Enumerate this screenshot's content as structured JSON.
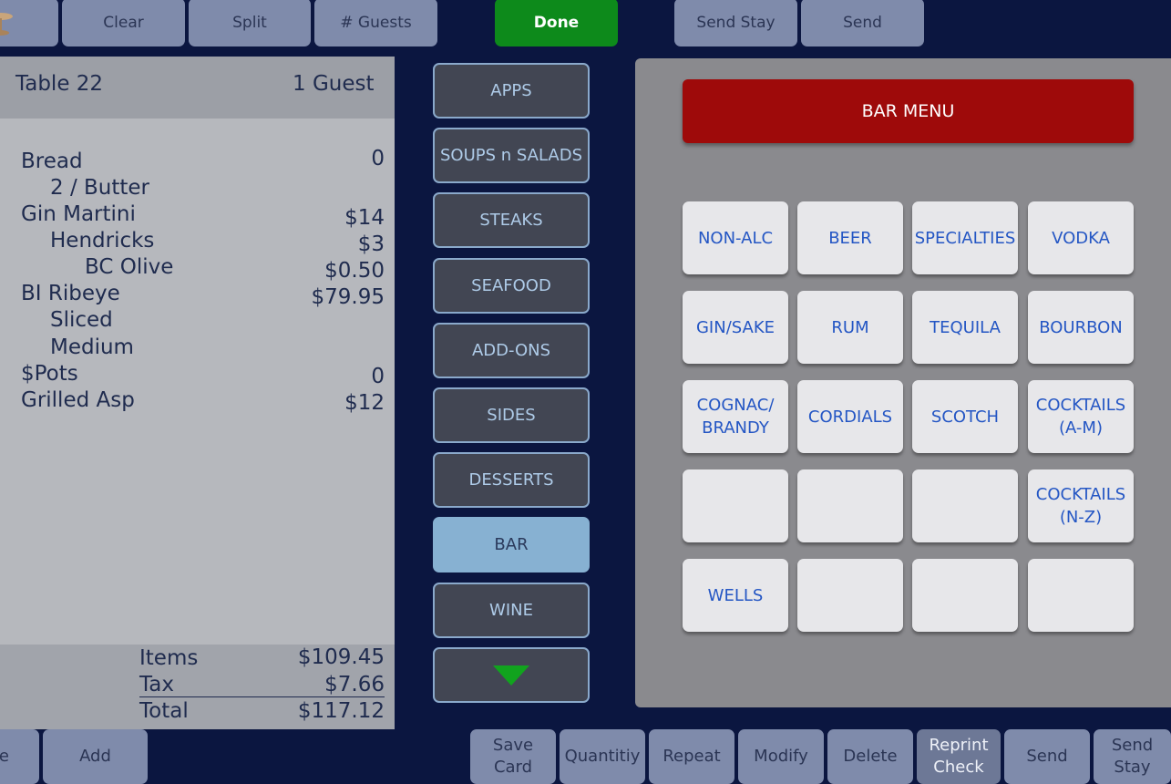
{
  "top_bar": {
    "clear": "Clear",
    "split": "Split",
    "guests": "# Guests",
    "done": "Done",
    "send_stay": "Send Stay",
    "send": "Send"
  },
  "check": {
    "table": "Table 22",
    "guests": "1 Guest",
    "items": [
      {
        "name": "Bread",
        "price": "0"
      },
      {
        "name": "2 / Butter",
        "price": ""
      },
      {
        "name": "Gin Martini",
        "price": "$14"
      },
      {
        "name": "Hendricks",
        "price": "$3"
      },
      {
        "name": "BC Olive",
        "price": "$0.50"
      },
      {
        "name": "BI Ribeye",
        "price": "$79.95"
      },
      {
        "name": "Sliced",
        "price": ""
      },
      {
        "name": "Medium",
        "price": ""
      },
      {
        "name": "$Pots",
        "price": "0"
      },
      {
        "name": "Grilled Asp",
        "price": "$12"
      }
    ],
    "totals": {
      "items_label": "Items",
      "items_value": "$109.45",
      "tax_label": "Tax",
      "tax_value": "$7.66",
      "total_label": "Total",
      "total_value": "$117.12"
    }
  },
  "categories": [
    "APPS",
    "SOUPS n SALADS",
    "STEAKS",
    "SEAFOOD",
    "ADD-ONS",
    "SIDES",
    "DESSERTS",
    "BAR",
    "WINE"
  ],
  "active_category": "BAR",
  "menu": {
    "title": "BAR MENU",
    "buttons": [
      [
        "NON-ALC",
        "BEER",
        "SPECIALTIES",
        "VODKA"
      ],
      [
        "GIN/SAKE",
        "RUM",
        "TEQUILA",
        "BOURBON"
      ],
      [
        "COGNAC/\nBRANDY",
        "CORDIALS",
        "SCOTCH",
        "COCKTAILS\n(A-M)"
      ],
      [
        "",
        "",
        "",
        "COCKTAILS\n(N-Z)"
      ],
      [
        "WELLS",
        "",
        "",
        ""
      ]
    ]
  },
  "bottom_bar": {
    "partial_left": "e",
    "add": "Add",
    "save_card": "Save\nCard",
    "quantity": "Quantitiy",
    "repeat": "Repeat",
    "modify": "Modify",
    "delete": "Delete",
    "reprint_check": "Reprint\nCheck",
    "send": "Send",
    "send_stay": "Send\nStay"
  },
  "colors": {
    "background": "#0b1640",
    "done": "#0d8a1b",
    "bar_menu": "#9e0a0a",
    "active_category": "#87b1d2"
  }
}
